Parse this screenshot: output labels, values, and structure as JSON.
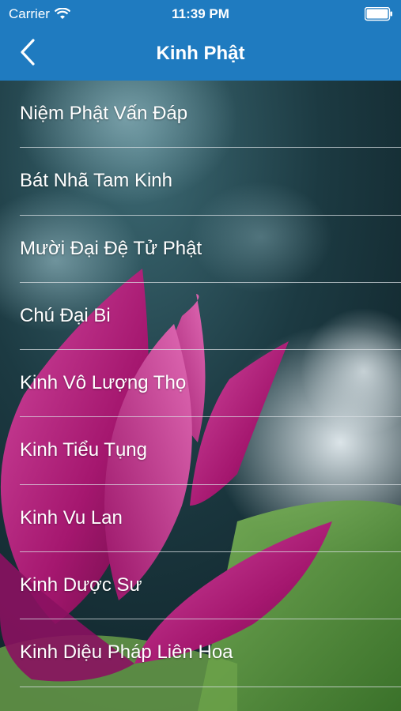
{
  "status_bar": {
    "carrier": "Carrier",
    "time": "11:39 PM",
    "wifi_icon": "wifi-icon",
    "battery_icon": "battery-icon"
  },
  "nav": {
    "title": "Kinh Phật",
    "back_icon": "chevron-left-icon"
  },
  "list": {
    "items": [
      "Niệm Phật Vấn Đáp",
      "Bát Nhã Tam Kinh",
      "Mười Đại Đệ Tử Phật",
      "Chú Đại Bi",
      "Kinh Vô Lượng Thọ",
      "Kinh Tiểu Tụng",
      "Kinh Vu Lan",
      "Kinh Dược Sư",
      "Kinh Diệu Pháp Liên Hoa"
    ]
  },
  "colors": {
    "nav_blue": "#1f7bc0",
    "lotus_pink": "#b01f7e"
  }
}
